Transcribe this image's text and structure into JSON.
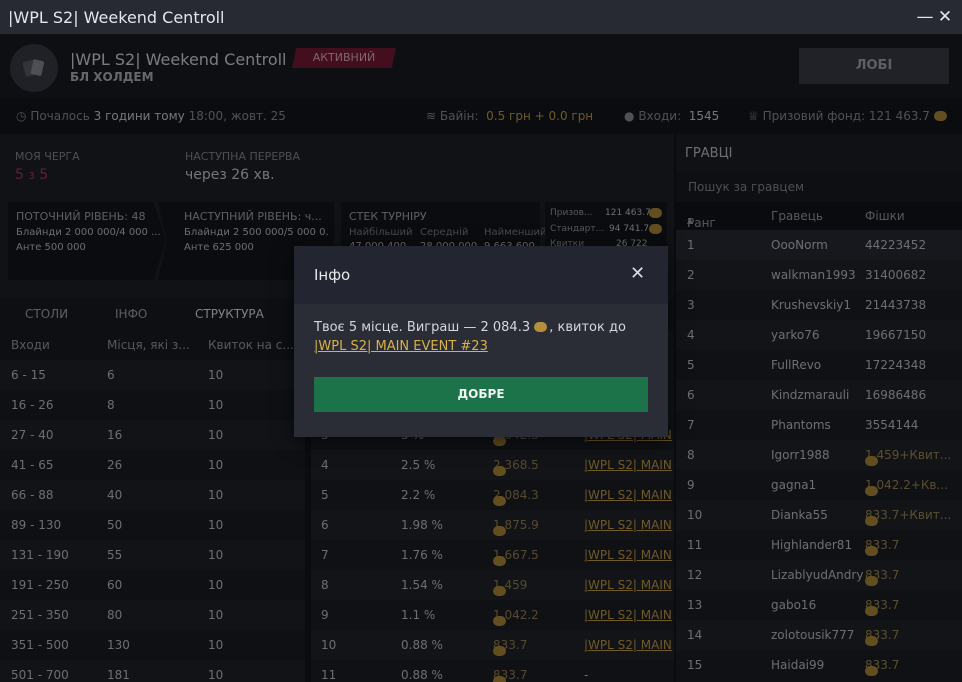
{
  "window": {
    "title": "|WPL S2| Weekend Centroll",
    "minimize": "—",
    "close": "✕"
  },
  "header": {
    "title": "|WPL S2| Weekend Centroll",
    "subtitle": "БЛ ХОЛДЕМ",
    "status": "АКТИВНИЙ",
    "lobby_button": "ЛОБІ"
  },
  "infobar": {
    "started_label": "Почалось",
    "started_value": "3 години тому",
    "started_time": "18:00, жовт. 25",
    "buyin_label": "Байін:",
    "buyin_value": "0.5 грн + 0.0 грн",
    "entries_label": "Входи:",
    "entries_value": "1545",
    "prize_label": "Призовий фонд:",
    "prize_value": "121 463.7"
  },
  "queue": {
    "label": "МОЯ ЧЕРГА",
    "value_a": "5",
    "value_sep": "з",
    "value_b": "5"
  },
  "break": {
    "label": "НАСТУПНА ПЕРЕРВА",
    "value": "через 26 хв."
  },
  "levels": {
    "current": {
      "title": "ПОТОЧНИЙ РІВЕНЬ: 48",
      "blinds": "Блайнди 2 000 000/4 000 ...",
      "ante": "Анте 500 000"
    },
    "next": {
      "title": "НАСТУПНИЙ РІВЕНЬ: ч...",
      "blinds": "Блайнди 2 500 000/5 000 0...",
      "ante": "Анте 625 000"
    },
    "stack": {
      "title": "СТЕК ТУРНІРУ",
      "largest": "Найбільший",
      "average": "Середній",
      "smallest": "Найменший",
      "largest_v": "47 000 400",
      "average_v": "28 000 000",
      "smallest_v": "9 663 600"
    },
    "prizes": [
      {
        "label": "Призов...",
        "value": "121 463.7"
      },
      {
        "label": "Стандарт...",
        "value": "94 741.7"
      },
      {
        "label": "Квитки",
        "value": "26 722"
      }
    ]
  },
  "tabs": [
    "СТОЛИ",
    "ІНФО",
    "СТРУКТУРА"
  ],
  "entries_table": {
    "headers": [
      "Входи",
      "Місця, які з...",
      "Квиток на с..."
    ],
    "rows": [
      [
        "6 - 15",
        "6",
        "10"
      ],
      [
        "16 - 26",
        "8",
        "10"
      ],
      [
        "27 - 40",
        "16",
        "10"
      ],
      [
        "41 - 65",
        "26",
        "10"
      ],
      [
        "66 - 88",
        "40",
        "10"
      ],
      [
        "89 - 130",
        "50",
        "10"
      ],
      [
        "131 - 190",
        "55",
        "10"
      ],
      [
        "191 - 250",
        "60",
        "10"
      ],
      [
        "251 - 350",
        "80",
        "10"
      ],
      [
        "351 - 500",
        "130",
        "10"
      ],
      [
        "501 - 700",
        "181",
        "10"
      ]
    ]
  },
  "payout_table": {
    "rows": [
      [
        "3",
        "3 %",
        "2 642.3",
        "|WPL S2| MAIN"
      ],
      [
        "4",
        "2.5 %",
        "2 368.5",
        "|WPL S2| MAIN"
      ],
      [
        "5",
        "2.2 %",
        "2 084.3",
        "|WPL S2| MAIN"
      ],
      [
        "6",
        "1.98 %",
        "1 875.9",
        "|WPL S2| MAIN"
      ],
      [
        "7",
        "1.76 %",
        "1 667.5",
        "|WPL S2| MAIN"
      ],
      [
        "8",
        "1.54 %",
        "1 459",
        "|WPL S2| MAIN"
      ],
      [
        "9",
        "1.1 %",
        "1 042.2",
        "|WPL S2| MAIN"
      ],
      [
        "10",
        "0.88 %",
        "833.7",
        "|WPL S2| MAIN"
      ],
      [
        "11",
        "0.88 %",
        "833.7",
        "-"
      ]
    ]
  },
  "players": {
    "title": "ГРАВЦІ",
    "search_placeholder": "Пошук за гравцем",
    "headers": [
      "Ранг",
      "Гравець",
      "Фішки"
    ],
    "sort_icon": "▲",
    "rows": [
      [
        "1",
        "OooNorm",
        "44223452",
        ""
      ],
      [
        "2",
        "walkman1993",
        "31400682",
        ""
      ],
      [
        "3",
        "Krushevskiy1",
        "21443738",
        ""
      ],
      [
        "4",
        "yarko76",
        "19667150",
        ""
      ],
      [
        "5",
        "FullRevo",
        "17224348",
        ""
      ],
      [
        "6",
        "Kindzmarauli",
        "16986486",
        ""
      ],
      [
        "7",
        "Phantoms",
        "3554144",
        ""
      ],
      [
        "8",
        "Igorr1988",
        "1 459+Квит...",
        "coin"
      ],
      [
        "9",
        "gagna1",
        "1 042.2+Кв...",
        "coin"
      ],
      [
        "10",
        "Dianka55",
        "833.7+Квит...",
        "coin"
      ],
      [
        "11",
        "Highlander81",
        "833.7",
        "coin"
      ],
      [
        "12",
        "LizablyudAndry",
        "833.7",
        "coin"
      ],
      [
        "13",
        "gabo16",
        "833.7",
        "coin"
      ],
      [
        "14",
        "zolotousik777",
        "833.7",
        "coin"
      ],
      [
        "15",
        "Haidai99",
        "833.7",
        "coin"
      ]
    ]
  },
  "modal": {
    "title": "Інфо",
    "close": "✕",
    "message_pre": "Твоє 5 місце. Виграш — 2 084.3",
    "message_mid": ", квиток до",
    "message_link": "|WPL S2| MAIN EVENT #23",
    "ok": "ДОБРЕ"
  }
}
